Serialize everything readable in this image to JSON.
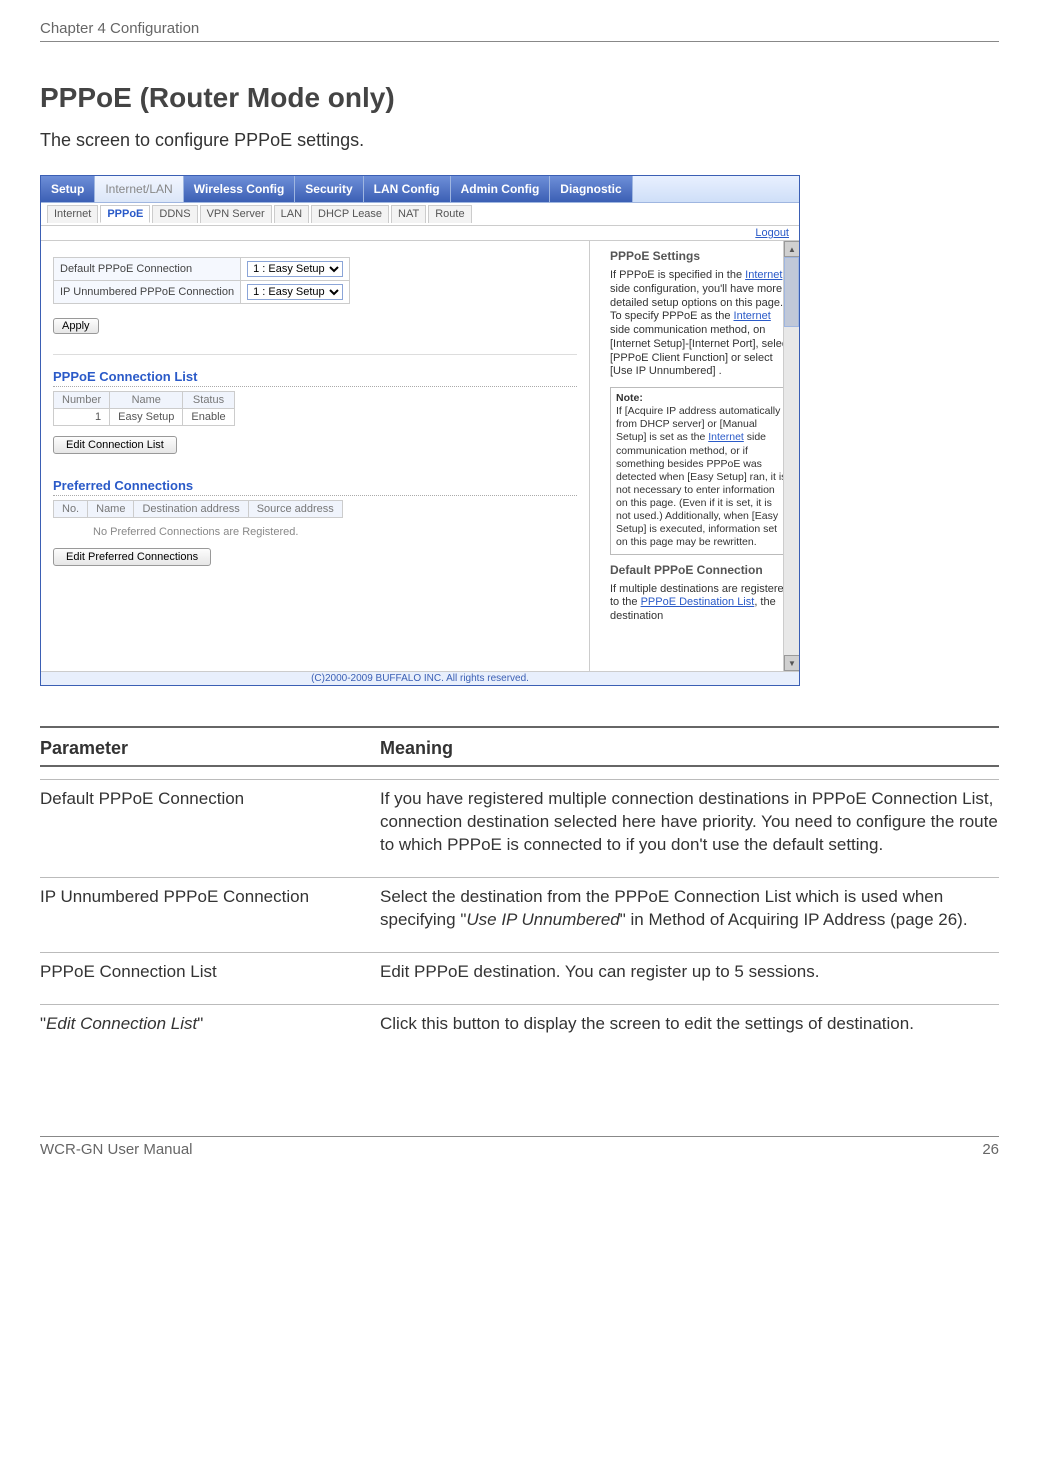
{
  "header": {
    "left": "Chapter 4  Configuration"
  },
  "title": "PPPoE (Router Mode only)",
  "intro": "The screen to configure PPPoE settings.",
  "shot": {
    "top_tabs": [
      "Setup",
      "Internet/LAN",
      "Wireless Config",
      "Security",
      "LAN Config",
      "Admin Config",
      "Diagnostic"
    ],
    "top_active_index": 1,
    "sub_tabs": [
      "Internet",
      "PPPoE",
      "DDNS",
      "VPN Server",
      "LAN",
      "DHCP Lease",
      "NAT",
      "Route"
    ],
    "sub_active_index": 1,
    "logout": "Logout",
    "form": {
      "rows": [
        {
          "label": "Default PPPoE Connection",
          "value": "1 : Easy Setup"
        },
        {
          "label": "IP Unnumbered PPPoE Connection",
          "value": "1 : Easy Setup"
        }
      ],
      "apply": "Apply"
    },
    "conn_list": {
      "heading": "PPPoE Connection List",
      "cols": [
        "Number",
        "Name",
        "Status"
      ],
      "row": [
        "1",
        "Easy Setup",
        "Enable"
      ],
      "button": "Edit Connection List"
    },
    "pref": {
      "heading": "Preferred Connections",
      "cols": [
        "No.",
        "Name",
        "Destination address",
        "Source address"
      ],
      "empty": "No Preferred Connections are Registered.",
      "button": "Edit Preferred Connections"
    },
    "footer": "(C)2000-2009 BUFFALO INC. All rights reserved.",
    "help": {
      "title": "PPPoE Settings",
      "p1a": "If PPPoE is specified in the ",
      "p1link1": "Internet",
      "p1b": " side configuration, you'll have more detailed setup options on this page. To specify PPPoE as the ",
      "p1link2": "Internet",
      "p1c": " side communication method, on [Internet Setup]-[Internet Port], select [PPPoE Client Function] or select [Use IP Unnumbered] .",
      "note_label": "Note:",
      "note_a": "If [Acquire IP address automatically from DHCP server] or [Manual Setup] is set as the ",
      "note_link": "Internet",
      "note_b": " side communication method, or if something besides PPPoE was detected when [Easy Setup] ran, it is not necessary to enter information on this page. (Even if it is set, it is not used.) Additionally, when [Easy Setup] is executed, information set on this page may be rewritten.",
      "h2": "Default PPPoE Connection",
      "p2a": "If multiple destinations are registered to the ",
      "p2link": "PPPoE Destination List",
      "p2b": ", the destination"
    }
  },
  "pm": {
    "head_param": "Parameter",
    "head_meaning": "Meaning",
    "rows": [
      {
        "param": "Default PPPoE Connection",
        "meaning": "If you have registered multiple connection destinations in PPPoE Connection List, connection destination selected here have priority. You need to configure the route to which PPPoE is connected to if you don't use the default setting."
      },
      {
        "param": "IP Unnumbered PPPoE Connection",
        "meaning_pre": "Select the destination from the PPPoE Connection List which is used when specifying \"",
        "meaning_em": "Use IP Unnumbered",
        "meaning_post": "\" in Method of Acquiring IP Address (page 26)."
      },
      {
        "param": "PPPoE Connection List",
        "meaning": "Edit PPPoE destination. You can register up to 5 sessions."
      },
      {
        "param_pre": "\"",
        "param_em": "Edit Connection List",
        "param_post": "\"",
        "meaning": "Click this button to display the screen to edit the settings of destination."
      }
    ]
  },
  "footer": {
    "left": "WCR-GN User Manual",
    "right": "26"
  }
}
